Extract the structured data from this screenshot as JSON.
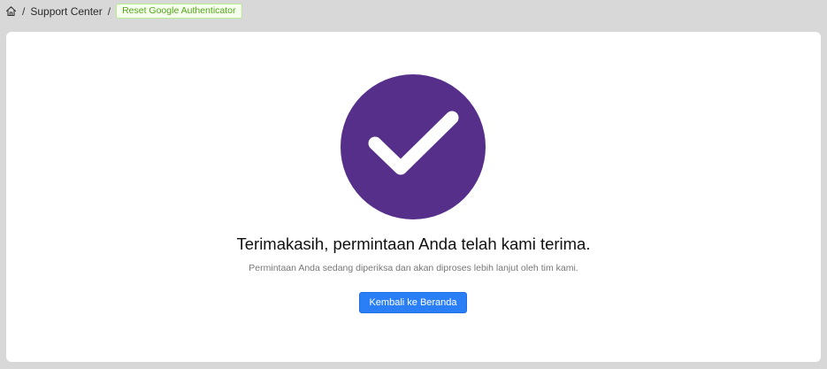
{
  "breadcrumb": {
    "home_icon": "home-icon",
    "separator": "/",
    "items": [
      {
        "label": "Support Center"
      },
      {
        "label": "Reset Google Authenticator",
        "current": true
      }
    ]
  },
  "success": {
    "icon": "checkmark-icon",
    "circle_color": "#552f8a",
    "title": "Terimakasih, permintaan Anda telah kami terima.",
    "subtitle": "Permintaan Anda sedang diperiksa dan akan diproses lebih lanjut oleh tim kami.",
    "button_label": "Kembali ke Beranda",
    "button_color": "#2a7ff7"
  },
  "colors": {
    "page_background": "#d8d8d8",
    "card_background": "#ffffff",
    "current_crumb_text": "#52a61a"
  }
}
